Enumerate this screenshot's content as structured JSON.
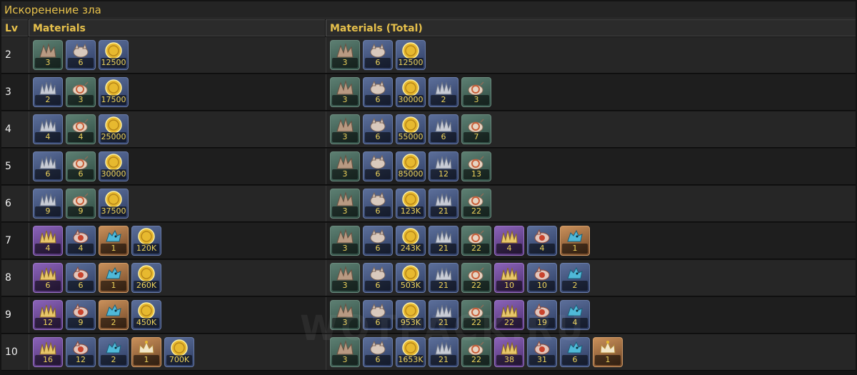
{
  "title": "Искоренение зла",
  "headers": {
    "lv": "Lv",
    "materials": "Materials",
    "total": "Materials (Total)"
  },
  "watermark": "WOTPACK.RU",
  "colors": {
    "accent": "#e6c04b",
    "green": "#4f7467",
    "blue": "#4f6290",
    "purple": "#7c57a8",
    "orange": "#b87f4c"
  },
  "rows": [
    {
      "lv": "2",
      "materials": [
        {
          "icon": "shell-icon",
          "tier": "green",
          "qty": "3"
        },
        {
          "icon": "boar-icon",
          "tier": "blue",
          "qty": "6"
        },
        {
          "icon": "coin-icon",
          "tier": "blue",
          "qty": "12500"
        }
      ],
      "total": [
        {
          "icon": "shell-icon",
          "tier": "green",
          "qty": "3"
        },
        {
          "icon": "boar-icon",
          "tier": "blue",
          "qty": "6"
        },
        {
          "icon": "coin-icon",
          "tier": "blue",
          "qty": "12500"
        }
      ]
    },
    {
      "lv": "3",
      "materials": [
        {
          "icon": "spiked-shell-icon",
          "tier": "blue",
          "qty": "2"
        },
        {
          "icon": "snail-icon",
          "tier": "green",
          "qty": "3"
        },
        {
          "icon": "coin-icon",
          "tier": "blue",
          "qty": "17500"
        }
      ],
      "total": [
        {
          "icon": "shell-icon",
          "tier": "green",
          "qty": "3"
        },
        {
          "icon": "boar-icon",
          "tier": "blue",
          "qty": "6"
        },
        {
          "icon": "coin-icon",
          "tier": "blue",
          "qty": "30000"
        },
        {
          "icon": "spiked-shell-icon",
          "tier": "blue",
          "qty": "2"
        },
        {
          "icon": "snail-icon",
          "tier": "green",
          "qty": "3"
        }
      ]
    },
    {
      "lv": "4",
      "materials": [
        {
          "icon": "spiked-shell-icon",
          "tier": "blue",
          "qty": "4"
        },
        {
          "icon": "snail-icon",
          "tier": "green",
          "qty": "4"
        },
        {
          "icon": "coin-icon",
          "tier": "blue",
          "qty": "25000"
        }
      ],
      "total": [
        {
          "icon": "shell-icon",
          "tier": "green",
          "qty": "3"
        },
        {
          "icon": "boar-icon",
          "tier": "blue",
          "qty": "6"
        },
        {
          "icon": "coin-icon",
          "tier": "blue",
          "qty": "55000"
        },
        {
          "icon": "spiked-shell-icon",
          "tier": "blue",
          "qty": "6"
        },
        {
          "icon": "snail-icon",
          "tier": "green",
          "qty": "7"
        }
      ]
    },
    {
      "lv": "5",
      "materials": [
        {
          "icon": "spiked-shell-icon",
          "tier": "blue",
          "qty": "6"
        },
        {
          "icon": "snail-icon",
          "tier": "green",
          "qty": "6"
        },
        {
          "icon": "coin-icon",
          "tier": "blue",
          "qty": "30000"
        }
      ],
      "total": [
        {
          "icon": "shell-icon",
          "tier": "green",
          "qty": "3"
        },
        {
          "icon": "boar-icon",
          "tier": "blue",
          "qty": "6"
        },
        {
          "icon": "coin-icon",
          "tier": "blue",
          "qty": "85000"
        },
        {
          "icon": "spiked-shell-icon",
          "tier": "blue",
          "qty": "12"
        },
        {
          "icon": "snail-icon",
          "tier": "green",
          "qty": "13"
        }
      ]
    },
    {
      "lv": "6",
      "materials": [
        {
          "icon": "spiked-shell-icon",
          "tier": "blue",
          "qty": "9"
        },
        {
          "icon": "snail-icon",
          "tier": "green",
          "qty": "9"
        },
        {
          "icon": "coin-icon",
          "tier": "blue",
          "qty": "37500"
        }
      ],
      "total": [
        {
          "icon": "shell-icon",
          "tier": "green",
          "qty": "3"
        },
        {
          "icon": "boar-icon",
          "tier": "blue",
          "qty": "6"
        },
        {
          "icon": "coin-icon",
          "tier": "blue",
          "qty": "123K"
        },
        {
          "icon": "spiked-shell-icon",
          "tier": "blue",
          "qty": "21"
        },
        {
          "icon": "snail-icon",
          "tier": "green",
          "qty": "22"
        }
      ]
    },
    {
      "lv": "7",
      "materials": [
        {
          "icon": "golden-shell-icon",
          "tier": "purple",
          "qty": "4"
        },
        {
          "icon": "red-boar-icon",
          "tier": "blue",
          "qty": "4"
        },
        {
          "icon": "blue-wolf-icon",
          "tier": "orange",
          "qty": "1"
        },
        {
          "icon": "coin-icon",
          "tier": "blue",
          "qty": "120K"
        }
      ],
      "total": [
        {
          "icon": "shell-icon",
          "tier": "green",
          "qty": "3"
        },
        {
          "icon": "boar-icon",
          "tier": "blue",
          "qty": "6"
        },
        {
          "icon": "coin-icon",
          "tier": "blue",
          "qty": "243K"
        },
        {
          "icon": "spiked-shell-icon",
          "tier": "blue",
          "qty": "21"
        },
        {
          "icon": "snail-icon",
          "tier": "green",
          "qty": "22"
        },
        {
          "icon": "golden-shell-icon",
          "tier": "purple",
          "qty": "4"
        },
        {
          "icon": "red-boar-icon",
          "tier": "blue",
          "qty": "4"
        },
        {
          "icon": "blue-wolf-icon",
          "tier": "orange",
          "qty": "1"
        }
      ]
    },
    {
      "lv": "8",
      "materials": [
        {
          "icon": "golden-shell-icon",
          "tier": "purple",
          "qty": "6"
        },
        {
          "icon": "red-boar-icon",
          "tier": "blue",
          "qty": "6"
        },
        {
          "icon": "blue-wolf-icon",
          "tier": "orange",
          "qty": "1"
        },
        {
          "icon": "coin-icon",
          "tier": "blue",
          "qty": "260K"
        }
      ],
      "total": [
        {
          "icon": "shell-icon",
          "tier": "green",
          "qty": "3"
        },
        {
          "icon": "boar-icon",
          "tier": "blue",
          "qty": "6"
        },
        {
          "icon": "coin-icon",
          "tier": "blue",
          "qty": "503K"
        },
        {
          "icon": "spiked-shell-icon",
          "tier": "blue",
          "qty": "21"
        },
        {
          "icon": "snail-icon",
          "tier": "green",
          "qty": "22"
        },
        {
          "icon": "golden-shell-icon",
          "tier": "purple",
          "qty": "10"
        },
        {
          "icon": "red-boar-icon",
          "tier": "blue",
          "qty": "10"
        },
        {
          "icon": "blue-wolf-icon",
          "tier": "blue",
          "qty": "2"
        }
      ]
    },
    {
      "lv": "9",
      "materials": [
        {
          "icon": "golden-shell-icon",
          "tier": "purple",
          "qty": "12"
        },
        {
          "icon": "red-boar-icon",
          "tier": "blue",
          "qty": "9"
        },
        {
          "icon": "blue-wolf-icon",
          "tier": "orange",
          "qty": "2"
        },
        {
          "icon": "coin-icon",
          "tier": "blue",
          "qty": "450K"
        }
      ],
      "total": [
        {
          "icon": "shell-icon",
          "tier": "green",
          "qty": "3"
        },
        {
          "icon": "boar-icon",
          "tier": "blue",
          "qty": "6"
        },
        {
          "icon": "coin-icon",
          "tier": "blue",
          "qty": "953K"
        },
        {
          "icon": "spiked-shell-icon",
          "tier": "blue",
          "qty": "21"
        },
        {
          "icon": "snail-icon",
          "tier": "green",
          "qty": "22"
        },
        {
          "icon": "golden-shell-icon",
          "tier": "purple",
          "qty": "22"
        },
        {
          "icon": "red-boar-icon",
          "tier": "blue",
          "qty": "19"
        },
        {
          "icon": "blue-wolf-icon",
          "tier": "blue",
          "qty": "4"
        }
      ]
    },
    {
      "lv": "10",
      "materials": [
        {
          "icon": "golden-shell-icon",
          "tier": "purple",
          "qty": "16"
        },
        {
          "icon": "red-boar-icon",
          "tier": "blue",
          "qty": "12"
        },
        {
          "icon": "blue-wolf-icon",
          "tier": "blue",
          "qty": "2"
        },
        {
          "icon": "crown-icon",
          "tier": "orange",
          "qty": "1"
        },
        {
          "icon": "coin-icon",
          "tier": "blue",
          "qty": "700K"
        }
      ],
      "total": [
        {
          "icon": "shell-icon",
          "tier": "green",
          "qty": "3"
        },
        {
          "icon": "boar-icon",
          "tier": "blue",
          "qty": "6"
        },
        {
          "icon": "coin-icon",
          "tier": "blue",
          "qty": "1653K"
        },
        {
          "icon": "spiked-shell-icon",
          "tier": "blue",
          "qty": "21"
        },
        {
          "icon": "snail-icon",
          "tier": "green",
          "qty": "22"
        },
        {
          "icon": "golden-shell-icon",
          "tier": "purple",
          "qty": "38"
        },
        {
          "icon": "red-boar-icon",
          "tier": "blue",
          "qty": "31"
        },
        {
          "icon": "blue-wolf-icon",
          "tier": "blue",
          "qty": "6"
        },
        {
          "icon": "crown-icon",
          "tier": "orange",
          "qty": "1"
        }
      ]
    }
  ]
}
